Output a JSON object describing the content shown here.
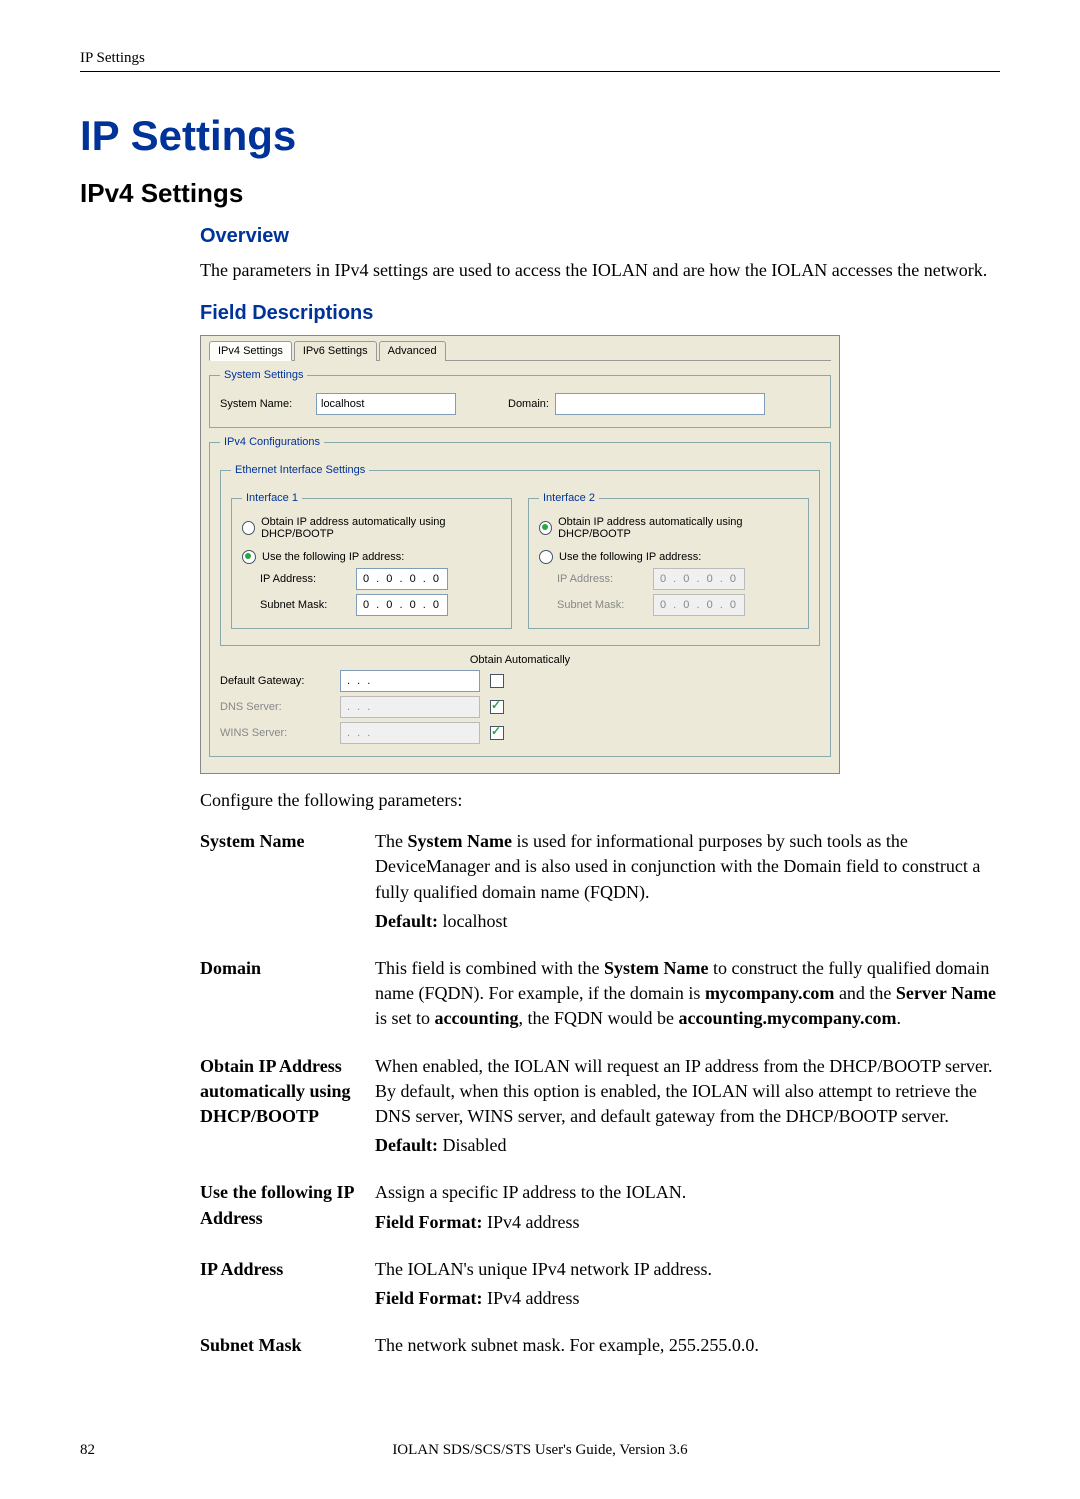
{
  "header": {
    "running": "IP Settings"
  },
  "title": "IP Settings",
  "section": "IPv4 Settings",
  "overview": {
    "heading": "Overview",
    "text": "The parameters in IPv4 settings are used to access the IOLAN and are how the IOLAN accesses the network."
  },
  "field_desc": {
    "heading": "Field Descriptions",
    "configure": "Configure the following parameters:"
  },
  "ui": {
    "tabs": [
      "IPv4 Settings",
      "IPv6 Settings",
      "Advanced"
    ],
    "system_settings": {
      "legend": "System Settings",
      "system_name_label": "System Name:",
      "system_name_value": "localhost",
      "domain_label": "Domain:",
      "domain_value": ""
    },
    "ipv4_config": {
      "legend": "IPv4 Configurations",
      "eth_legend": "Ethernet Interface Settings",
      "iface1": {
        "legend": "Interface 1",
        "obtain_label": "Obtain IP address automatically using DHCP/BOOTP",
        "obtain_checked": false,
        "use_label": "Use the following IP address:",
        "use_checked": true,
        "ip_label": "IP Address:",
        "ip_value": "0 . 0 . 0 . 0",
        "mask_label": "Subnet Mask:",
        "mask_value": "0 . 0 . 0 . 0"
      },
      "iface2": {
        "legend": "Interface 2",
        "obtain_label": "Obtain IP address automatically using DHCP/BOOTP",
        "obtain_checked": true,
        "use_label": "Use the following IP address:",
        "use_checked": false,
        "ip_label": "IP Address:",
        "ip_value": "0 . 0 . 0 . 0",
        "mask_label": "Subnet Mask:",
        "mask_value": "0 . 0 . 0 . 0"
      },
      "obtain_auto_header": "Obtain Automatically",
      "gateway_label": "Default Gateway:",
      "gateway_value": " .  .  . ",
      "gateway_auto": false,
      "dns_label": "DNS Server:",
      "dns_value": " .  .  . ",
      "dns_auto": true,
      "wins_label": "WINS Server:",
      "wins_value": " .  .  . ",
      "wins_auto": true
    }
  },
  "params": {
    "system_name": {
      "name": "System Name",
      "t1a": "The ",
      "t1b": "System Name",
      "t1c": " is used for informational purposes by such tools as the DeviceManager and is also used in conjunction with the Domain field to construct a fully qualified domain name (FQDN).",
      "def_label": "Default:",
      "def_val": " localhost"
    },
    "domain": {
      "name": "Domain",
      "t1a": "This field is combined with the ",
      "t1b": "System Name",
      "t1c": " to construct the fully qualified domain name (FQDN). For example, if the domain is ",
      "t1d": "mycompany.com",
      "t1e": " and the ",
      "t1f": "Server Name",
      "t1g": " is set to ",
      "t1h": "accounting",
      "t1i": ", the FQDN would be ",
      "t1j": "accounting.mycompany.com",
      "t1k": "."
    },
    "obtain": {
      "name": "Obtain IP Address automatically using DHCP/BOOTP",
      "t1": "When enabled, the IOLAN will request an IP address from the DHCP/BOOTP server. By default, when this option is enabled, the IOLAN will also attempt to retrieve the DNS server, WINS server, and default gateway from the DHCP/BOOTP server.",
      "def_label": "Default:",
      "def_val": " Disabled"
    },
    "usefollowing": {
      "name": "Use the following IP Address",
      "t1": "Assign a specific IP address to the IOLAN.",
      "ff_label": "Field Format:",
      "ff_val": " IPv4 address"
    },
    "ipaddress": {
      "name": "IP Address",
      "t1": "The IOLAN's unique IPv4 network IP address.",
      "ff_label": "Field Format:",
      "ff_val": " IPv4 address"
    },
    "subnet": {
      "name": "Subnet Mask",
      "t1": "The network subnet mask. For example, 255.255.0.0."
    }
  },
  "footer": {
    "page": "82",
    "mid": "IOLAN SDS/SCS/STS User's Guide, Version 3.6"
  }
}
